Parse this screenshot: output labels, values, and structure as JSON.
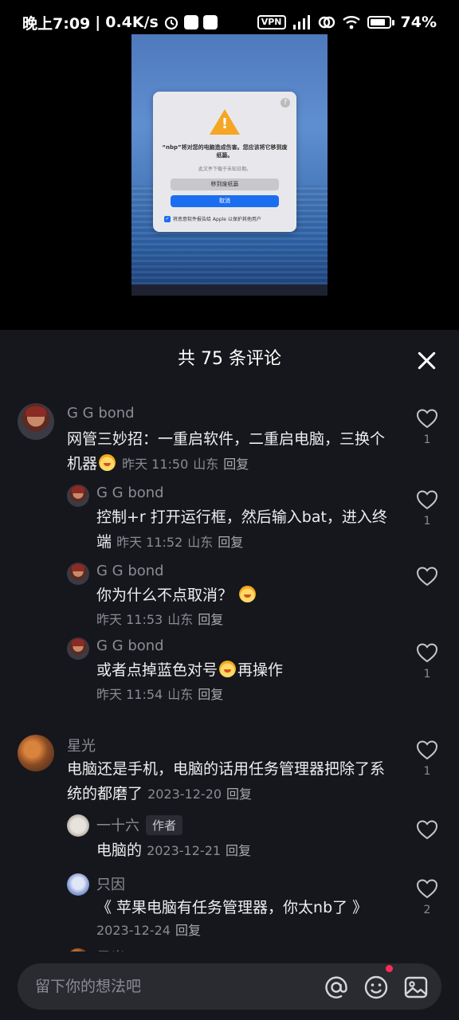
{
  "status_bar": {
    "time": "晚上7:09",
    "speed": "0.4K/s",
    "vpn": "VPN",
    "battery": "74%",
    "battery_level": 0.74
  },
  "media": {
    "dialog": {
      "help": "?",
      "message": "“nbp”将对您的电脑造成伤害。您应该将它移到废纸篓。",
      "sub": "此文件下载于未知日期。",
      "move_button": "移到废纸篓",
      "cancel_button": "取消",
      "checkbox_label": "将恶意软件报告给 Apple 以保护其他用户"
    }
  },
  "panel": {
    "title": "共 75 条评论"
  },
  "comments": [
    {
      "name": "G G bond",
      "text": "网管三妙招：一重启软件，二重启电脑，三换个机器",
      "time": "昨天 11:50",
      "location": "山东",
      "reply": "回复",
      "likes": "1"
    },
    {
      "name": "G G bond",
      "text": "控制+r 打开运行框，然后输入bat，进入终端",
      "time": "昨天 11:52",
      "location": "山东",
      "reply": "回复",
      "likes": "1"
    },
    {
      "name": "G G bond",
      "text": "你为什么不点取消？",
      "time": "昨天 11:53",
      "location": "山东",
      "reply": "回复",
      "likes": ""
    },
    {
      "name": "G G bond",
      "text_before": "或者点掉蓝色对号",
      "text_after": "再操作",
      "time": "昨天 11:54",
      "location": "山东",
      "reply": "回复",
      "likes": "1"
    },
    {
      "name": "星光",
      "text": "电脑还是手机，电脑的话用任务管理器把除了系统的都磨了",
      "time": "2023-12-20",
      "reply": "回复",
      "likes": "1"
    },
    {
      "name": "一十六",
      "tag": "作者",
      "text": "电脑的",
      "time": "2023-12-21",
      "reply": "回复",
      "likes": ""
    },
    {
      "name": "只因",
      "text": "《 苹果电脑有任务管理器，你太nb了 》",
      "time": "2023-12-24",
      "reply": "回复",
      "likes": "2"
    },
    {
      "name": "星光"
    }
  ],
  "input_bar": {
    "placeholder": "留下你的想法吧"
  },
  "icons": [
    "mention-icon",
    "emoji-icon",
    "image-icon",
    "heart-icon",
    "close-icon",
    "warning-icon"
  ]
}
